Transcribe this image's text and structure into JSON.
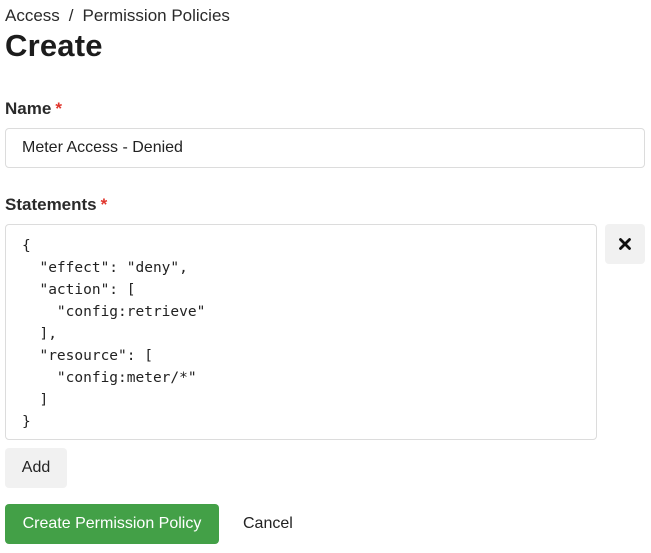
{
  "breadcrumb": {
    "items": [
      "Access",
      "Permission Policies"
    ],
    "separator": "/"
  },
  "page": {
    "title": "Create"
  },
  "form": {
    "name": {
      "label": "Name",
      "required_marker": "*",
      "value": "Meter Access - Denied"
    },
    "statements": {
      "label": "Statements",
      "required_marker": "*",
      "items": [
        {
          "code": "{\n  \"effect\": \"deny\",\n  \"action\": [\n    \"config:retrieve\"\n  ],\n  \"resource\": [\n    \"config:meter/*\"\n  ]\n}",
          "remove_icon": "close-icon"
        }
      ],
      "add_label": "Add"
    }
  },
  "actions": {
    "submit_label": "Create Permission Policy",
    "cancel_label": "Cancel"
  },
  "colors": {
    "primary": "#43a047",
    "required": "#e0342b",
    "secondary_button_bg": "#f1f1f1"
  }
}
